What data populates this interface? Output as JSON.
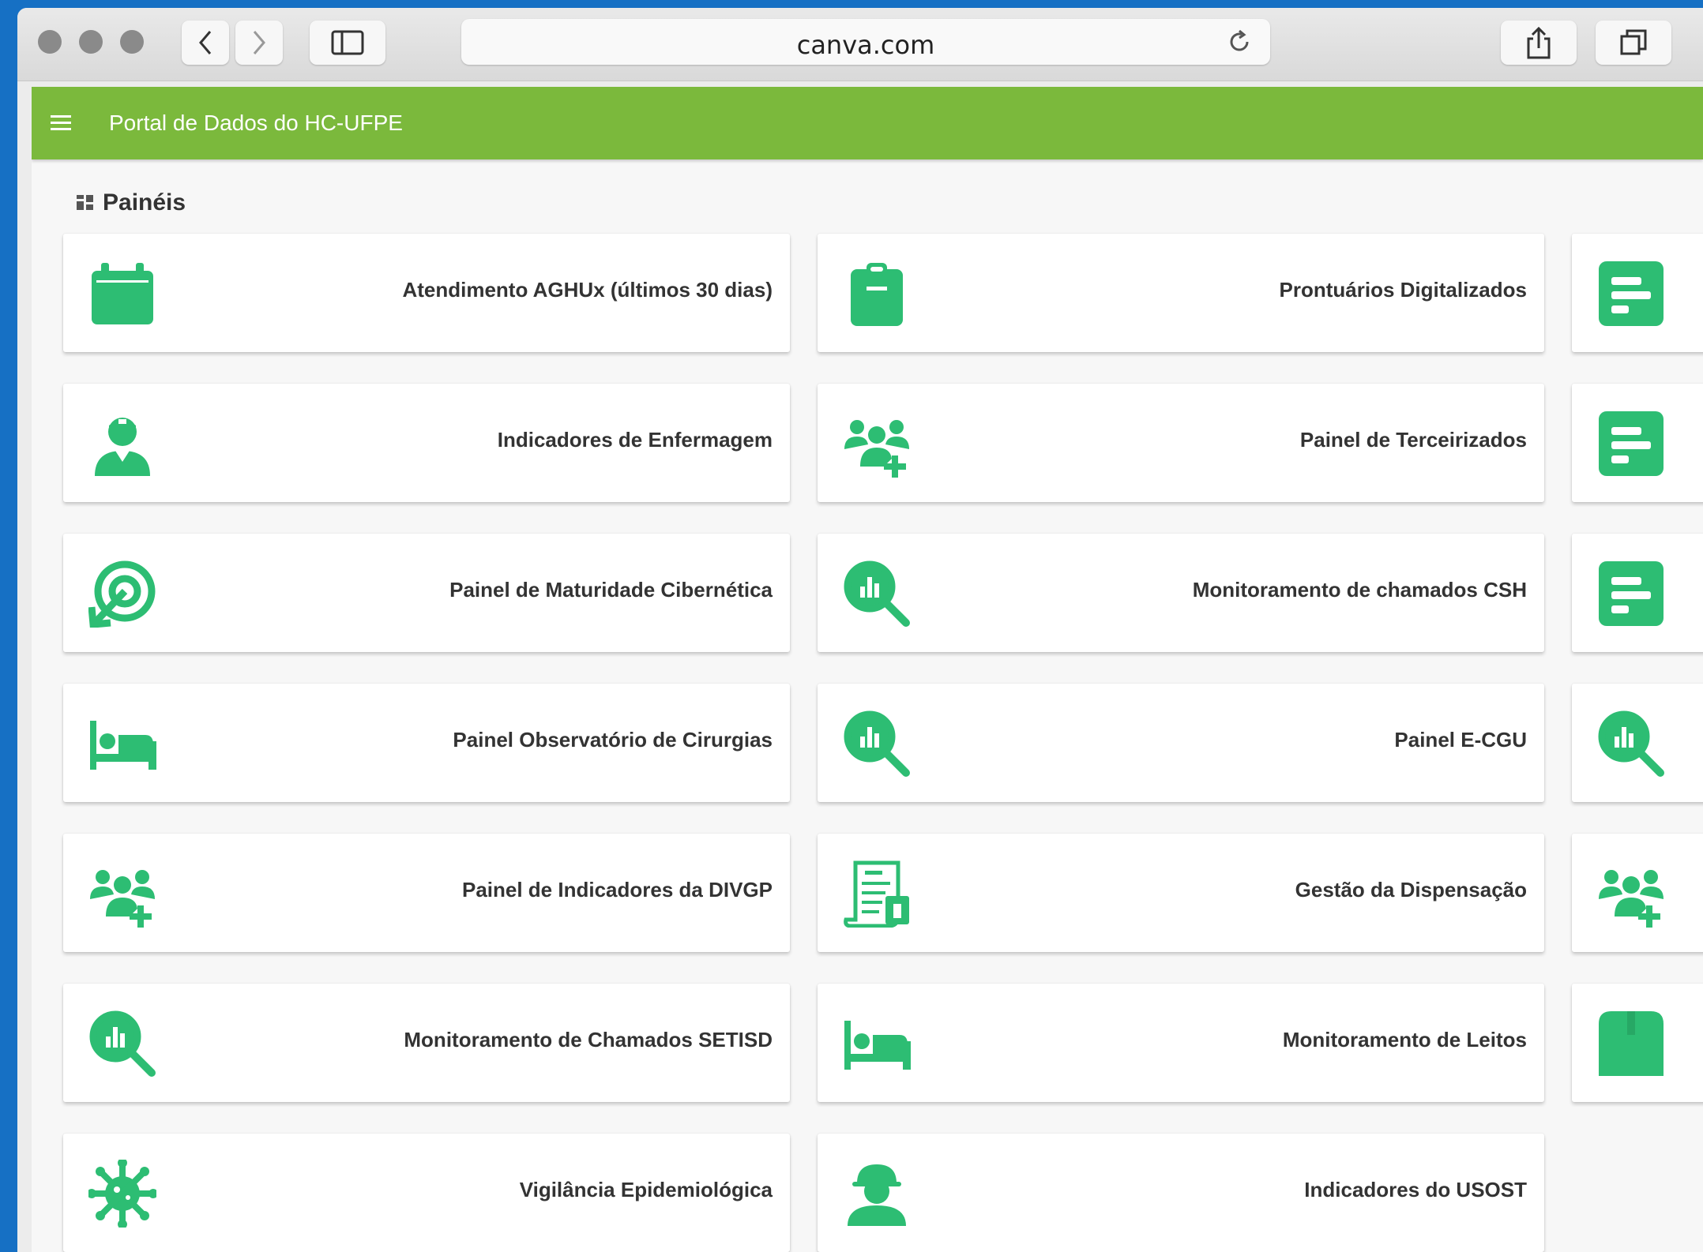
{
  "browser": {
    "url": "canva.com"
  },
  "app": {
    "title": "Portal de Dados do HC-UFPE"
  },
  "section": {
    "title": "Painéis"
  },
  "theme": {
    "accent": "#7bb93c",
    "icon_color": "#2dbd73"
  },
  "cards": [
    {
      "label": "Atendimento AGHUx (últimos 30 dias)",
      "icon": "calendar-icon"
    },
    {
      "label": "Prontuários Digitalizados",
      "icon": "clipboard-icon"
    },
    {
      "label": "",
      "icon": "document-chart-icon"
    },
    {
      "label": "Indicadores de Enfermagem",
      "icon": "nurse-icon"
    },
    {
      "label": "Painel de Terceirizados",
      "icon": "user-group-add-icon"
    },
    {
      "label": "",
      "icon": "document-chart-icon"
    },
    {
      "label": "Painel de Maturidade Cibernética",
      "icon": "target-arrow-icon"
    },
    {
      "label": "Monitoramento de chamados CSH",
      "icon": "chart-search-icon"
    },
    {
      "label": "",
      "icon": "document-chart-icon"
    },
    {
      "label": "Painel Observatório de Cirurgias",
      "icon": "bed-icon"
    },
    {
      "label": "Painel E-CGU",
      "icon": "chart-search-icon"
    },
    {
      "label": "",
      "icon": "chart-search-icon"
    },
    {
      "label": "Painel de Indicadores da DIVGP",
      "icon": "user-group-add-icon"
    },
    {
      "label": "Gestão da Dispensação",
      "icon": "prescription-icon"
    },
    {
      "label": "",
      "icon": "user-group-add-icon"
    },
    {
      "label": "Monitoramento de Chamados SETISD",
      "icon": "chart-search-icon"
    },
    {
      "label": "Monitoramento de Leitos",
      "icon": "bed-icon"
    },
    {
      "label": "",
      "icon": "box-icon"
    },
    {
      "label": "Vigilância Epidemiológica",
      "icon": "virus-icon"
    },
    {
      "label": "Indicadores do USOST",
      "icon": "worker-icon"
    }
  ]
}
